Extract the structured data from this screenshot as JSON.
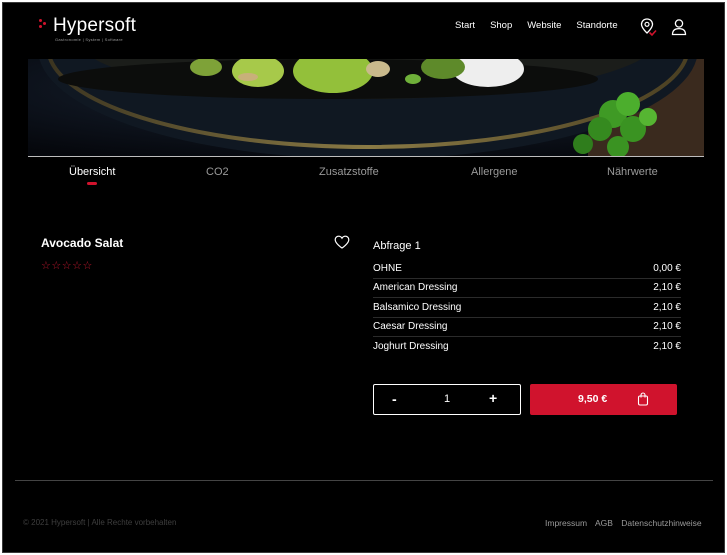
{
  "brand": {
    "name": "Hypersoft",
    "tagline": "Gastronomie | System | Software",
    "accent_color": "#d0132d"
  },
  "nav": {
    "items": [
      "Start",
      "Shop",
      "Website",
      "Standorte"
    ],
    "location_icon": "map-pin-icon",
    "account_icon": "user-icon"
  },
  "hero": {
    "image": "salad-bowl-photo"
  },
  "tabs": {
    "items": [
      "Übersicht",
      "CO2",
      "Zusatzstoffe",
      "Allergene",
      "Nährwerte"
    ],
    "active_index": 0
  },
  "product": {
    "name": "Avocado Salat",
    "rating_stars": "☆☆☆☆☆",
    "rating": 0,
    "favorite_icon": "heart-icon"
  },
  "options": {
    "title": "Abfrage 1",
    "rows": [
      {
        "label": "OHNE",
        "price": "0,00 €"
      },
      {
        "label": "American Dressing",
        "price": "2,10 €"
      },
      {
        "label": "Balsamico Dressing",
        "price": "2,10 €"
      },
      {
        "label": "Caesar Dressing",
        "price": "2,10 €"
      },
      {
        "label": "Joghurt Dressing",
        "price": "2,10 €"
      }
    ]
  },
  "quantity": {
    "minus": "-",
    "value": "1",
    "plus": "+"
  },
  "cart": {
    "price": "9,50 €",
    "icon": "shopping-bag-icon"
  },
  "footer": {
    "copyright": "© 2021 Hypersoft | Alle Rechte vorbehalten",
    "links": [
      "Impressum",
      "AGB",
      "Datenschutzhinweise"
    ]
  }
}
